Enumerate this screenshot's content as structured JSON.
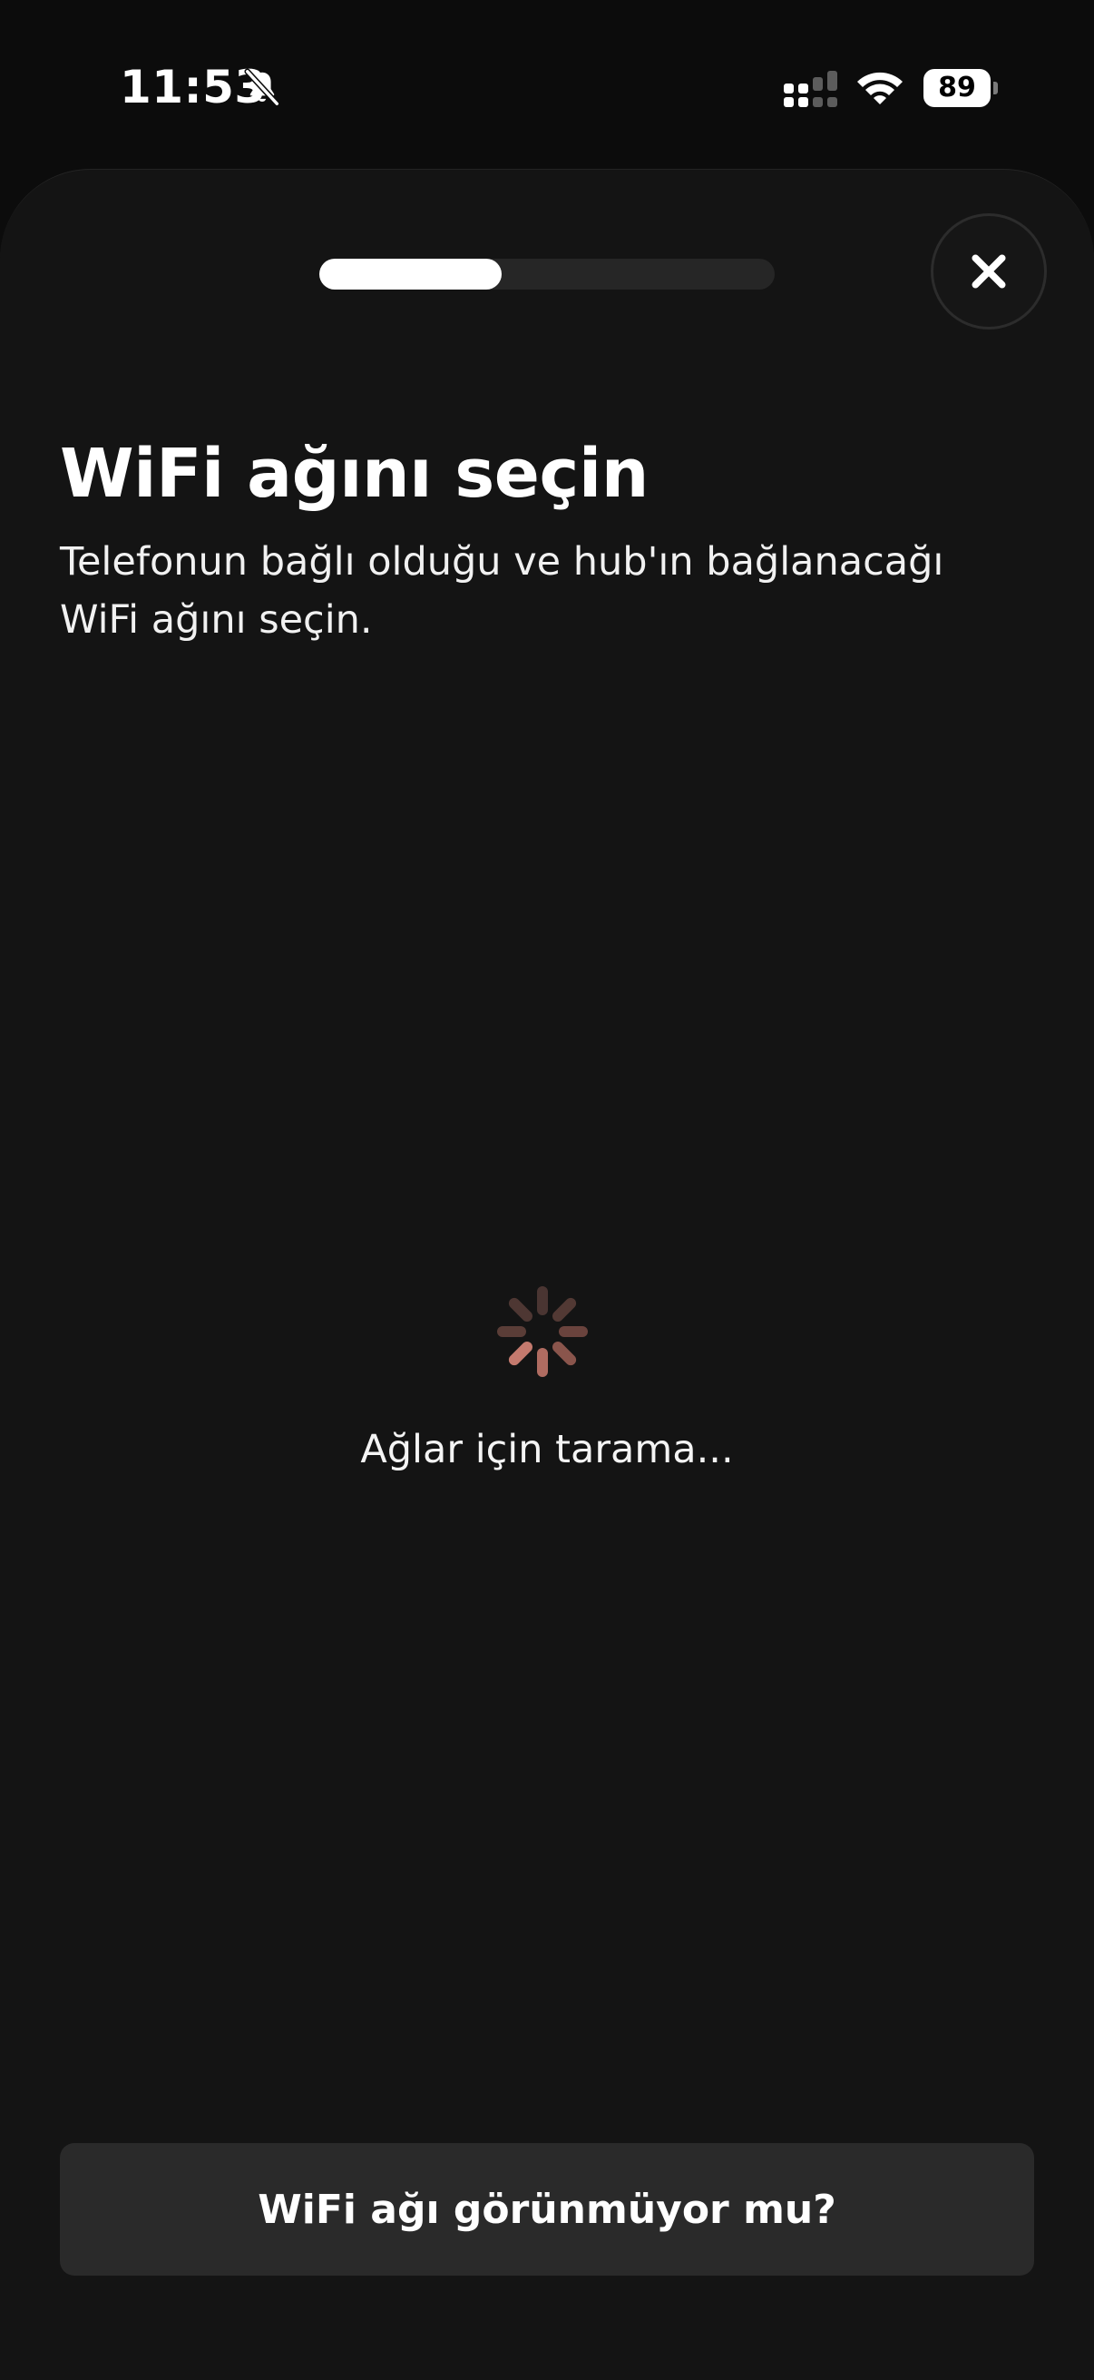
{
  "status_bar": {
    "time": "11:53",
    "battery_level": "89",
    "icons": [
      "bell-slash-icon",
      "cellular-signal-icon",
      "wifi-icon",
      "battery-icon"
    ]
  },
  "header": {
    "progress_fraction": 0.4,
    "close_icon": "close-icon"
  },
  "content": {
    "title": "WiFi ağını seçin",
    "subtitle": "Telefonun bağlı olduğu ve hub'ın bağlanacağı WiFi ağını seçin.",
    "scanning_label": "Ağlar için tarama..."
  },
  "footer": {
    "help_button_label": "WiFi ağı görünmüyor mu?"
  },
  "colors": {
    "background": "#141414",
    "spinner_accent": "#c47a6e",
    "button_background": "#2a2a2a"
  }
}
